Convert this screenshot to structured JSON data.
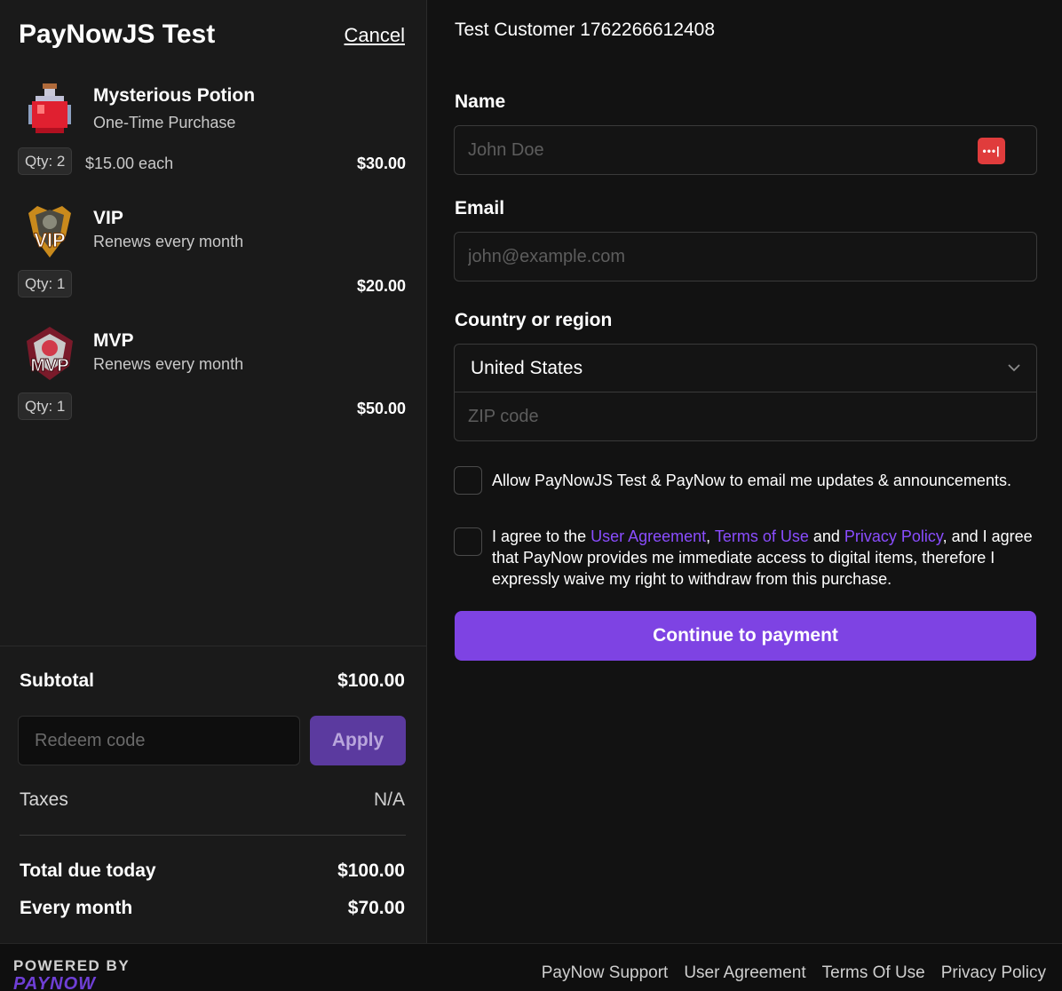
{
  "store": {
    "title": "PayNowJS Test",
    "cancel_label": "Cancel"
  },
  "cart": {
    "items": [
      {
        "name": "Mysterious Potion",
        "subtitle": "One-Time Purchase",
        "qty": "Qty: 2",
        "each": "$15.00 each",
        "price": "$30.00",
        "icon": "potion-icon"
      },
      {
        "name": "VIP",
        "subtitle": "Renews every month",
        "qty": "Qty: 1",
        "each": "",
        "price": "$20.00",
        "icon": "vip-icon"
      },
      {
        "name": "MVP",
        "subtitle": "Renews every month",
        "qty": "Qty: 1",
        "each": "",
        "price": "$50.00",
        "icon": "mvp-icon"
      }
    ]
  },
  "summary": {
    "subtotal_label": "Subtotal",
    "subtotal_value": "$100.00",
    "redeem_placeholder": "Redeem code",
    "apply_label": "Apply",
    "taxes_label": "Taxes",
    "taxes_value": "N/A",
    "total_label": "Total due today",
    "total_value": "$100.00",
    "monthly_label": "Every month",
    "monthly_value": "$70.00"
  },
  "form": {
    "customer": "Test Customer 1762266612408",
    "name_label": "Name",
    "name_placeholder": "John Doe",
    "email_label": "Email",
    "email_placeholder": "john@example.com",
    "country_label": "Country or region",
    "country_value": "United States",
    "zip_placeholder": "ZIP code",
    "marketing_text": "Allow PayNowJS Test & PayNow to email me updates & announcements.",
    "agree_prefix": "I agree to the ",
    "agree_link1": "User Agreement",
    "agree_sep1": ", ",
    "agree_link2": "Terms of Use",
    "agree_sep2": " and ",
    "agree_link3": "Privacy Policy",
    "agree_suffix": ", and I agree that PayNow provides me immediate access to digital items, therefore I expressly waive my right to withdraw from this purchase.",
    "continue_label": "Continue to payment"
  },
  "footer": {
    "powered_by": "POWERED BY",
    "brand": "PAYNOW",
    "links": [
      "PayNow Support",
      "User Agreement",
      "Terms Of Use",
      "Privacy Policy"
    ]
  },
  "colors": {
    "accent": "#7e43e3",
    "link": "#8a4dff",
    "password_manager": "#e03c3c"
  }
}
